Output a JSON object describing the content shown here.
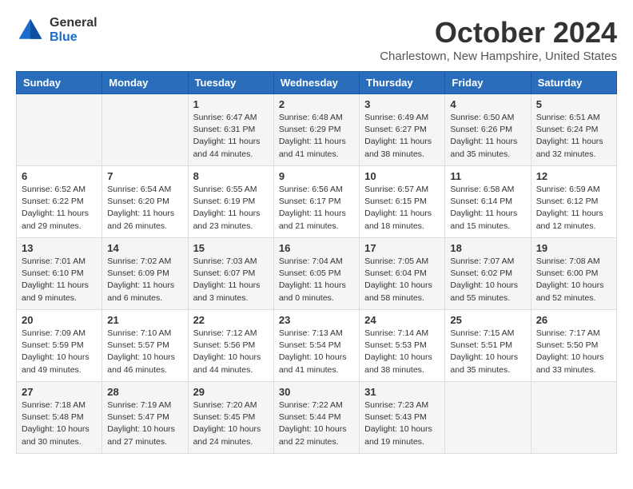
{
  "header": {
    "logo_general": "General",
    "logo_blue": "Blue",
    "month": "October 2024",
    "location": "Charlestown, New Hampshire, United States"
  },
  "days_of_week": [
    "Sunday",
    "Monday",
    "Tuesday",
    "Wednesday",
    "Thursday",
    "Friday",
    "Saturday"
  ],
  "weeks": [
    [
      {
        "day": "",
        "sunrise": "",
        "sunset": "",
        "daylight": ""
      },
      {
        "day": "",
        "sunrise": "",
        "sunset": "",
        "daylight": ""
      },
      {
        "day": "1",
        "sunrise": "Sunrise: 6:47 AM",
        "sunset": "Sunset: 6:31 PM",
        "daylight": "Daylight: 11 hours and 44 minutes."
      },
      {
        "day": "2",
        "sunrise": "Sunrise: 6:48 AM",
        "sunset": "Sunset: 6:29 PM",
        "daylight": "Daylight: 11 hours and 41 minutes."
      },
      {
        "day": "3",
        "sunrise": "Sunrise: 6:49 AM",
        "sunset": "Sunset: 6:27 PM",
        "daylight": "Daylight: 11 hours and 38 minutes."
      },
      {
        "day": "4",
        "sunrise": "Sunrise: 6:50 AM",
        "sunset": "Sunset: 6:26 PM",
        "daylight": "Daylight: 11 hours and 35 minutes."
      },
      {
        "day": "5",
        "sunrise": "Sunrise: 6:51 AM",
        "sunset": "Sunset: 6:24 PM",
        "daylight": "Daylight: 11 hours and 32 minutes."
      }
    ],
    [
      {
        "day": "6",
        "sunrise": "Sunrise: 6:52 AM",
        "sunset": "Sunset: 6:22 PM",
        "daylight": "Daylight: 11 hours and 29 minutes."
      },
      {
        "day": "7",
        "sunrise": "Sunrise: 6:54 AM",
        "sunset": "Sunset: 6:20 PM",
        "daylight": "Daylight: 11 hours and 26 minutes."
      },
      {
        "day": "8",
        "sunrise": "Sunrise: 6:55 AM",
        "sunset": "Sunset: 6:19 PM",
        "daylight": "Daylight: 11 hours and 23 minutes."
      },
      {
        "day": "9",
        "sunrise": "Sunrise: 6:56 AM",
        "sunset": "Sunset: 6:17 PM",
        "daylight": "Daylight: 11 hours and 21 minutes."
      },
      {
        "day": "10",
        "sunrise": "Sunrise: 6:57 AM",
        "sunset": "Sunset: 6:15 PM",
        "daylight": "Daylight: 11 hours and 18 minutes."
      },
      {
        "day": "11",
        "sunrise": "Sunrise: 6:58 AM",
        "sunset": "Sunset: 6:14 PM",
        "daylight": "Daylight: 11 hours and 15 minutes."
      },
      {
        "day": "12",
        "sunrise": "Sunrise: 6:59 AM",
        "sunset": "Sunset: 6:12 PM",
        "daylight": "Daylight: 11 hours and 12 minutes."
      }
    ],
    [
      {
        "day": "13",
        "sunrise": "Sunrise: 7:01 AM",
        "sunset": "Sunset: 6:10 PM",
        "daylight": "Daylight: 11 hours and 9 minutes."
      },
      {
        "day": "14",
        "sunrise": "Sunrise: 7:02 AM",
        "sunset": "Sunset: 6:09 PM",
        "daylight": "Daylight: 11 hours and 6 minutes."
      },
      {
        "day": "15",
        "sunrise": "Sunrise: 7:03 AM",
        "sunset": "Sunset: 6:07 PM",
        "daylight": "Daylight: 11 hours and 3 minutes."
      },
      {
        "day": "16",
        "sunrise": "Sunrise: 7:04 AM",
        "sunset": "Sunset: 6:05 PM",
        "daylight": "Daylight: 11 hours and 0 minutes."
      },
      {
        "day": "17",
        "sunrise": "Sunrise: 7:05 AM",
        "sunset": "Sunset: 6:04 PM",
        "daylight": "Daylight: 10 hours and 58 minutes."
      },
      {
        "day": "18",
        "sunrise": "Sunrise: 7:07 AM",
        "sunset": "Sunset: 6:02 PM",
        "daylight": "Daylight: 10 hours and 55 minutes."
      },
      {
        "day": "19",
        "sunrise": "Sunrise: 7:08 AM",
        "sunset": "Sunset: 6:00 PM",
        "daylight": "Daylight: 10 hours and 52 minutes."
      }
    ],
    [
      {
        "day": "20",
        "sunrise": "Sunrise: 7:09 AM",
        "sunset": "Sunset: 5:59 PM",
        "daylight": "Daylight: 10 hours and 49 minutes."
      },
      {
        "day": "21",
        "sunrise": "Sunrise: 7:10 AM",
        "sunset": "Sunset: 5:57 PM",
        "daylight": "Daylight: 10 hours and 46 minutes."
      },
      {
        "day": "22",
        "sunrise": "Sunrise: 7:12 AM",
        "sunset": "Sunset: 5:56 PM",
        "daylight": "Daylight: 10 hours and 44 minutes."
      },
      {
        "day": "23",
        "sunrise": "Sunrise: 7:13 AM",
        "sunset": "Sunset: 5:54 PM",
        "daylight": "Daylight: 10 hours and 41 minutes."
      },
      {
        "day": "24",
        "sunrise": "Sunrise: 7:14 AM",
        "sunset": "Sunset: 5:53 PM",
        "daylight": "Daylight: 10 hours and 38 minutes."
      },
      {
        "day": "25",
        "sunrise": "Sunrise: 7:15 AM",
        "sunset": "Sunset: 5:51 PM",
        "daylight": "Daylight: 10 hours and 35 minutes."
      },
      {
        "day": "26",
        "sunrise": "Sunrise: 7:17 AM",
        "sunset": "Sunset: 5:50 PM",
        "daylight": "Daylight: 10 hours and 33 minutes."
      }
    ],
    [
      {
        "day": "27",
        "sunrise": "Sunrise: 7:18 AM",
        "sunset": "Sunset: 5:48 PM",
        "daylight": "Daylight: 10 hours and 30 minutes."
      },
      {
        "day": "28",
        "sunrise": "Sunrise: 7:19 AM",
        "sunset": "Sunset: 5:47 PM",
        "daylight": "Daylight: 10 hours and 27 minutes."
      },
      {
        "day": "29",
        "sunrise": "Sunrise: 7:20 AM",
        "sunset": "Sunset: 5:45 PM",
        "daylight": "Daylight: 10 hours and 24 minutes."
      },
      {
        "day": "30",
        "sunrise": "Sunrise: 7:22 AM",
        "sunset": "Sunset: 5:44 PM",
        "daylight": "Daylight: 10 hours and 22 minutes."
      },
      {
        "day": "31",
        "sunrise": "Sunrise: 7:23 AM",
        "sunset": "Sunset: 5:43 PM",
        "daylight": "Daylight: 10 hours and 19 minutes."
      },
      {
        "day": "",
        "sunrise": "",
        "sunset": "",
        "daylight": ""
      },
      {
        "day": "",
        "sunrise": "",
        "sunset": "",
        "daylight": ""
      }
    ]
  ]
}
